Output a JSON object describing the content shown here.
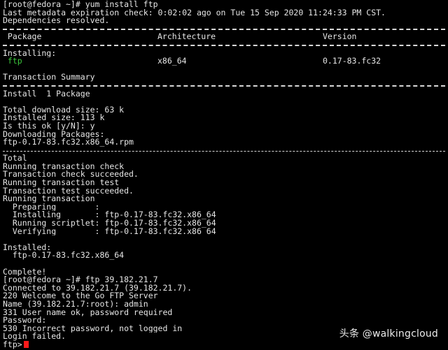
{
  "terminal": {
    "lines": {
      "l1": "[root@fedora ~]# yum install ftp",
      "l2": "Last metadata expiration check: 0:02:02 ago on Tue 15 Sep 2020 11:24:33 PM CST.",
      "l3": "Dependencies resolved.",
      "installing": "Installing:",
      "tx_summary": "Transaction Summary",
      "install_count": "Install  1 Package",
      "total_dl": "Total download size: 63 k",
      "installed_size": "Installed size: 113 k",
      "is_ok": "Is this ok [y/N]: y",
      "downloading": "Downloading Packages:",
      "rpm": "ftp-0.17-83.fc32.x86_64.rpm",
      "total": "Total",
      "run_check": "Running transaction check",
      "check_ok": "Transaction check succeeded.",
      "run_test": "Running transaction test",
      "test_ok": "Transaction test succeeded.",
      "running": "Running transaction",
      "preparing": "  Preparing        :",
      "installing_step": "  Installing       : ftp-0.17-83.fc32.x86_64",
      "scriptlet": "  Running scriptlet: ftp-0.17-83.fc32.x86_64",
      "verifying": "  Verifying        : ftp-0.17-83.fc32.x86_64",
      "installed": "Installed:",
      "installed_pkg": "  ftp-0.17-83.fc32.x86_64",
      "complete": "Complete!",
      "ftp_cmd": "[root@fedora ~]# ftp 39.182.21.7",
      "connected": "Connected to 39.182.21.7 (39.182.21.7).",
      "welcome": "220 Welcome to the Go FTP Server",
      "name": "Name (39.182.21.7:root): admin",
      "user_ok": "331 User name ok, password required",
      "password": "Password:",
      "incorrect": "530 Incorrect password, not logged in",
      "login_failed": "Login failed.",
      "prompt": "ftp>"
    },
    "table": {
      "headers": {
        "package": " Package",
        "architecture": "Architecture",
        "version": "Version"
      },
      "row": {
        "package": " ftp",
        "architecture": "x86_64",
        "version": "0.17-83.fc32"
      }
    },
    "colors": {
      "background": "#000000",
      "text": "#e6e6e6",
      "package_name": "#3cc83c",
      "cursor": "#ff1a1a"
    }
  },
  "watermark": {
    "text": "头条 @walkingcloud"
  }
}
